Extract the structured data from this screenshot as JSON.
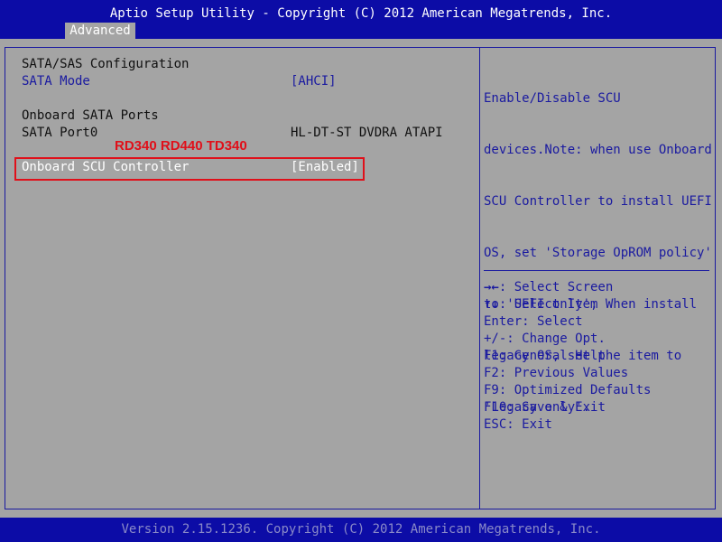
{
  "header": {
    "title": "Aptio Setup Utility - Copyright (C) 2012 American Megatrends, Inc.",
    "tab_active": "Advanced"
  },
  "main": {
    "section_title": "SATA/SAS Configuration",
    "sata_mode": {
      "label": "SATA Mode",
      "value": "[AHCI]"
    },
    "onboard_ports_title": "Onboard SATA Ports",
    "sata_port0": {
      "label": "SATA Port0",
      "value": "HL-DT-ST DVDRA ATAPI"
    },
    "annotation": "RD340 RD440 TD340",
    "scu_controller": {
      "label": "Onboard SCU Controller",
      "value": "[Enabled]"
    }
  },
  "help": {
    "lines": [
      "Enable/Disable SCU",
      "devices.Note: when use Onboard",
      "SCU Controller to install UEFI",
      "OS, set 'Storage OpROM policy'",
      "to 'UEFI only'; When install",
      "legacy OS, set the item to",
      "'Legacy only'."
    ]
  },
  "keys": [
    {
      "key": "→←",
      "desc": ": Select Screen"
    },
    {
      "key": "↑↓",
      "desc": ": Select Item"
    },
    {
      "key": "Enter",
      "desc": ": Select"
    },
    {
      "key": "+/-",
      "desc": ": Change Opt."
    },
    {
      "key": "F1",
      "desc": ": General Help"
    },
    {
      "key": "F2",
      "desc": ": Previous Values"
    },
    {
      "key": "F9",
      "desc": ": Optimized Defaults"
    },
    {
      "key": "F10",
      "desc": ": Save & Exit"
    },
    {
      "key": "ESC",
      "desc": ": Exit"
    }
  ],
  "footer": {
    "version": "Version 2.15.1236. Copyright (C) 2012 American Megatrends, Inc."
  },
  "colors": {
    "bar": "#0c0ca6",
    "background": "#a4a4a4",
    "accent": "#1a1aa0",
    "annotation": "#e0101a"
  }
}
